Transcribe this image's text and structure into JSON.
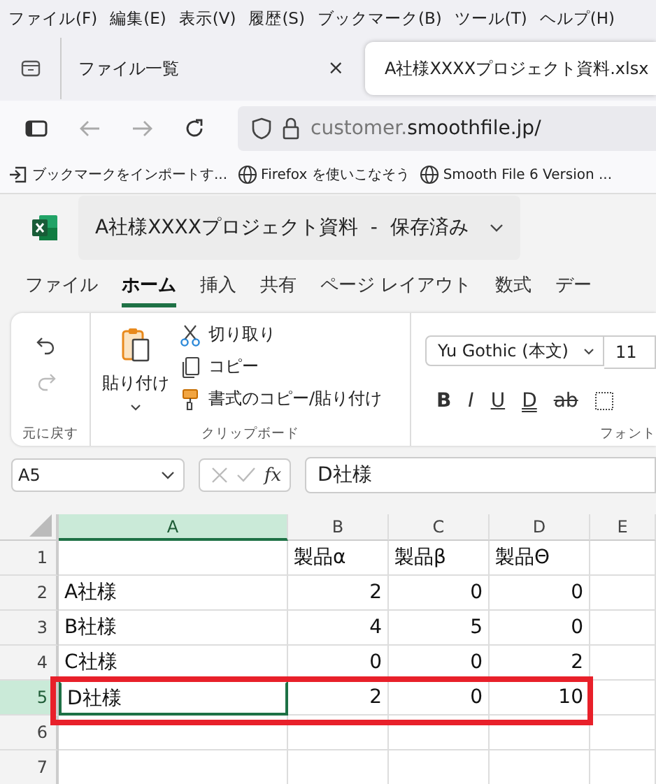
{
  "menu_bar": [
    "ファイル(F)",
    "編集(E)",
    "表示(V)",
    "履歴(S)",
    "ブックマーク(B)",
    "ツール(T)",
    "ヘルプ(H)"
  ],
  "browser_tabs": [
    {
      "title": "ファイル一覧",
      "close": "×",
      "selected": false
    },
    {
      "title": "A社様XXXXプロジェクト資料.xlsx",
      "selected": true
    }
  ],
  "address_bar": {
    "host_prefix": "customer.",
    "host": "smoothfile.jp/"
  },
  "bookmarks": [
    {
      "kind": "import",
      "label": "ブックマークをインポートす..."
    },
    {
      "kind": "globe",
      "label": "Firefox を使いこなそう"
    },
    {
      "kind": "globe",
      "label": "Smooth File 6 Version ..."
    }
  ],
  "workbook": {
    "title": "A社様XXXXプロジェクト資料  -  保存済み"
  },
  "ribbon_tabs": [
    {
      "label": "ファイル",
      "selected": false
    },
    {
      "label": "ホーム",
      "selected": true
    },
    {
      "label": "挿入",
      "selected": false
    },
    {
      "label": "共有",
      "selected": false
    },
    {
      "label": "ページ レイアウト",
      "selected": false
    },
    {
      "label": "数式",
      "selected": false
    },
    {
      "label": "デー",
      "selected": false
    }
  ],
  "ribbon": {
    "undo_group": {
      "redo_disabled": true,
      "label": "元に戻す"
    },
    "clipboard_group": {
      "paste": "貼り付け",
      "actions": [
        {
          "kind": "cut",
          "label": "切り取り"
        },
        {
          "kind": "copy",
          "label": "コピー"
        },
        {
          "kind": "format_painter",
          "label": "書式のコピー/貼り付け"
        }
      ],
      "label": "クリップボード"
    },
    "font_group": {
      "font_name": "Yu Gothic (本文)",
      "font_size": "11",
      "buttons": [
        {
          "kind": "bold",
          "label": "B"
        },
        {
          "kind": "italic",
          "label": "I"
        },
        {
          "kind": "underline",
          "label": "U"
        },
        {
          "kind": "double_underline",
          "label": "D"
        },
        {
          "kind": "strikethrough",
          "label": "ab"
        }
      ],
      "label": "フォント"
    }
  },
  "formula_bar": {
    "name_box": "A5",
    "fx": "fx",
    "value": "D社様"
  },
  "sheet": {
    "columns": [
      {
        "label": "A",
        "selected": true
      },
      {
        "label": "B",
        "selected": false
      },
      {
        "label": "C",
        "selected": false
      },
      {
        "label": "D",
        "selected": false
      },
      {
        "label": "E",
        "selected": false
      }
    ],
    "rows": [
      {
        "number": "1",
        "selected": false,
        "highlighted": false,
        "cells": [
          "",
          "製品α",
          "製品β",
          "製品Θ",
          ""
        ]
      },
      {
        "number": "2",
        "selected": false,
        "highlighted": false,
        "cells": [
          "A社様",
          "2",
          "0",
          "0",
          ""
        ]
      },
      {
        "number": "3",
        "selected": false,
        "highlighted": false,
        "cells": [
          "B社様",
          "4",
          "5",
          "0",
          ""
        ]
      },
      {
        "number": "4",
        "selected": false,
        "highlighted": false,
        "cells": [
          "C社様",
          "0",
          "0",
          "2",
          ""
        ]
      },
      {
        "number": "5",
        "selected": true,
        "highlighted": true,
        "cells": [
          "D社様",
          "2",
          "0",
          "10",
          ""
        ]
      },
      {
        "number": "6",
        "selected": false,
        "highlighted": false,
        "cells": [
          "",
          "",
          "",
          "",
          ""
        ]
      },
      {
        "number": "7",
        "selected": false,
        "highlighted": false,
        "cells": [
          "",
          "",
          "",
          "",
          ""
        ]
      }
    ]
  }
}
